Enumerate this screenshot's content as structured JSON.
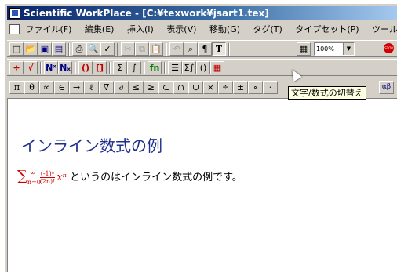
{
  "window": {
    "title": "Scientific WorkPlace - [C:¥texwork¥jsart1.tex]"
  },
  "menu": [
    "ファイル(F)",
    "編集(E)",
    "挿入(I)",
    "表示(V)",
    "移動(G)",
    "タグ(T)",
    "タイプセット(P)",
    "ツール(L)"
  ],
  "toolbar1": {
    "buttons": [
      {
        "name": "new-document-icon",
        "glyph": "□"
      },
      {
        "name": "open-folder-icon",
        "glyph": "📂"
      },
      {
        "name": "save-disk-icon",
        "glyph": "▣"
      },
      {
        "name": "save-all-icon",
        "glyph": "▤"
      },
      {
        "name": "print-icon",
        "glyph": "⎙"
      },
      {
        "name": "preview-icon",
        "glyph": "🔍"
      },
      {
        "name": "spellcheck-icon",
        "glyph": "✓"
      },
      {
        "name": "cut-icon",
        "glyph": "✂"
      },
      {
        "name": "copy-icon",
        "glyph": "⧉"
      },
      {
        "name": "paste-icon",
        "glyph": "📋"
      },
      {
        "name": "undo-icon",
        "glyph": "↶"
      },
      {
        "name": "find-icon",
        "glyph": "⌕"
      },
      {
        "name": "paragraph-mark-icon",
        "glyph": "¶"
      },
      {
        "name": "text-math-toggle-icon",
        "glyph": "T"
      },
      {
        "name": "table-icon",
        "glyph": "▦"
      }
    ],
    "zoom": "100%",
    "stop_label": "STOP"
  },
  "toolbar2": {
    "buttons": [
      {
        "name": "fraction-icon",
        "glyph": "÷"
      },
      {
        "name": "radical-icon",
        "glyph": "√"
      },
      {
        "name": "superscript-icon",
        "glyph": "Nˣ"
      },
      {
        "name": "subscript-icon",
        "glyph": "Nₓ"
      },
      {
        "name": "parentheses-icon",
        "glyph": "()"
      },
      {
        "name": "brackets-icon",
        "glyph": "[]"
      },
      {
        "name": "sum-operator-icon",
        "glyph": "Σ"
      },
      {
        "name": "integral-icon",
        "glyph": "∫"
      },
      {
        "name": "function-name-icon",
        "glyph": "fn"
      },
      {
        "name": "matrix-icon",
        "glyph": "☰"
      },
      {
        "name": "operator-icon",
        "glyph": "Σ∫"
      },
      {
        "name": "delimiters-icon",
        "glyph": "()"
      },
      {
        "name": "grid-icon",
        "glyph": "▦"
      }
    ],
    "tooltip": "文字/数式の切替え"
  },
  "symbol_bar": [
    "π",
    "θ",
    "∞",
    "∈",
    "→",
    "ℓ",
    "∇",
    "∂",
    "≤",
    "≥",
    "⊂",
    "∩",
    "∪",
    "×",
    "÷",
    "±",
    "∘",
    "·"
  ],
  "symbol_bar_end": "αβ",
  "document": {
    "heading": "インライン数式の例",
    "math": {
      "sigma": "∑",
      "upper": "∞",
      "lower": "n=0",
      "numerator": "(-1)ⁿ",
      "denominator": "(2n)!",
      "term": "xⁿ"
    },
    "text": "というのはインライン数式の例です。"
  },
  "colors": {
    "heading": "#1f2f8c",
    "math": "#d00000",
    "title_bar": "#0a246a"
  }
}
